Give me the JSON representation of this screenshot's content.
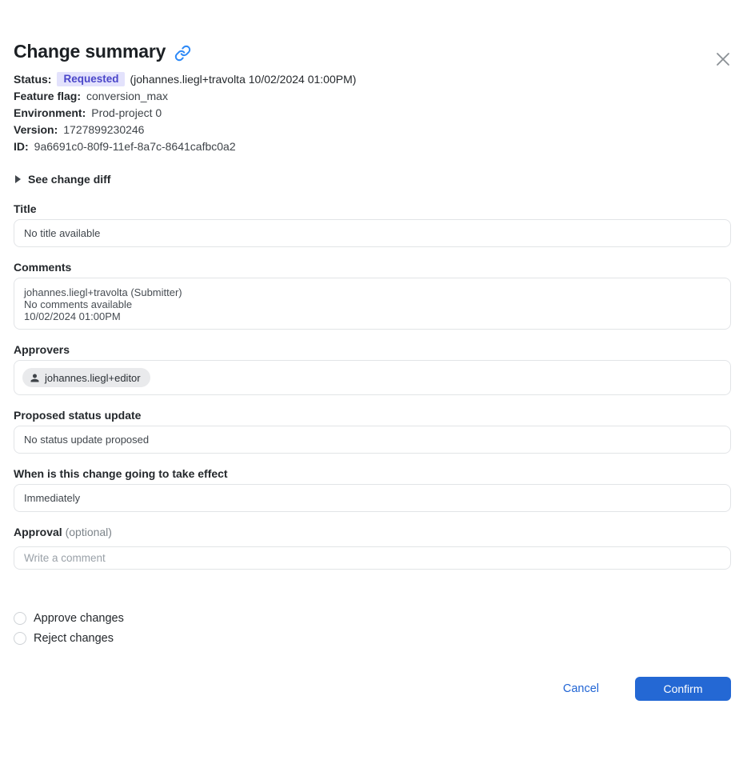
{
  "dialog": {
    "title": "Change summary"
  },
  "meta": {
    "status_label": "Status:",
    "status_badge": "Requested",
    "status_detail": "(johannes.liegl+travolta 10/02/2024 01:00PM)",
    "fields": [
      {
        "label": "Feature flag:",
        "value": "conversion_max"
      },
      {
        "label": "Environment:",
        "value": "Prod-project 0"
      },
      {
        "label": "Version:",
        "value": "1727899230246"
      },
      {
        "label": "ID:",
        "value": "9a6691c0-80f9-11ef-8a7c-8641cafbc0a2"
      }
    ]
  },
  "diff_toggle": {
    "label": "See change diff"
  },
  "sections": {
    "title": {
      "label": "Title",
      "value": "No title available"
    },
    "comments": {
      "label": "Comments",
      "lines": [
        "johannes.liegl+travolta (Submitter)",
        "No comments available",
        "10/02/2024 01:00PM"
      ]
    },
    "approvers": {
      "label": "Approvers",
      "chip": "johannes.liegl+editor"
    },
    "proposed_status": {
      "label": "Proposed status update",
      "value": "No status update proposed"
    },
    "effect": {
      "label": "When is this change going to take effect",
      "value": "Immediately"
    },
    "approval": {
      "label": "Approval",
      "optional": "(optional)",
      "placeholder": "Write a comment",
      "value": ""
    }
  },
  "choices": [
    {
      "label": "Approve changes"
    },
    {
      "label": "Reject changes"
    }
  ],
  "footer": {
    "cancel": "Cancel",
    "confirm": "Confirm"
  },
  "colors": {
    "accent_blue": "#2468d4",
    "link_blue": "#2e8af7",
    "badge_bg": "#e3e2fc",
    "badge_text": "#4a46c9"
  }
}
